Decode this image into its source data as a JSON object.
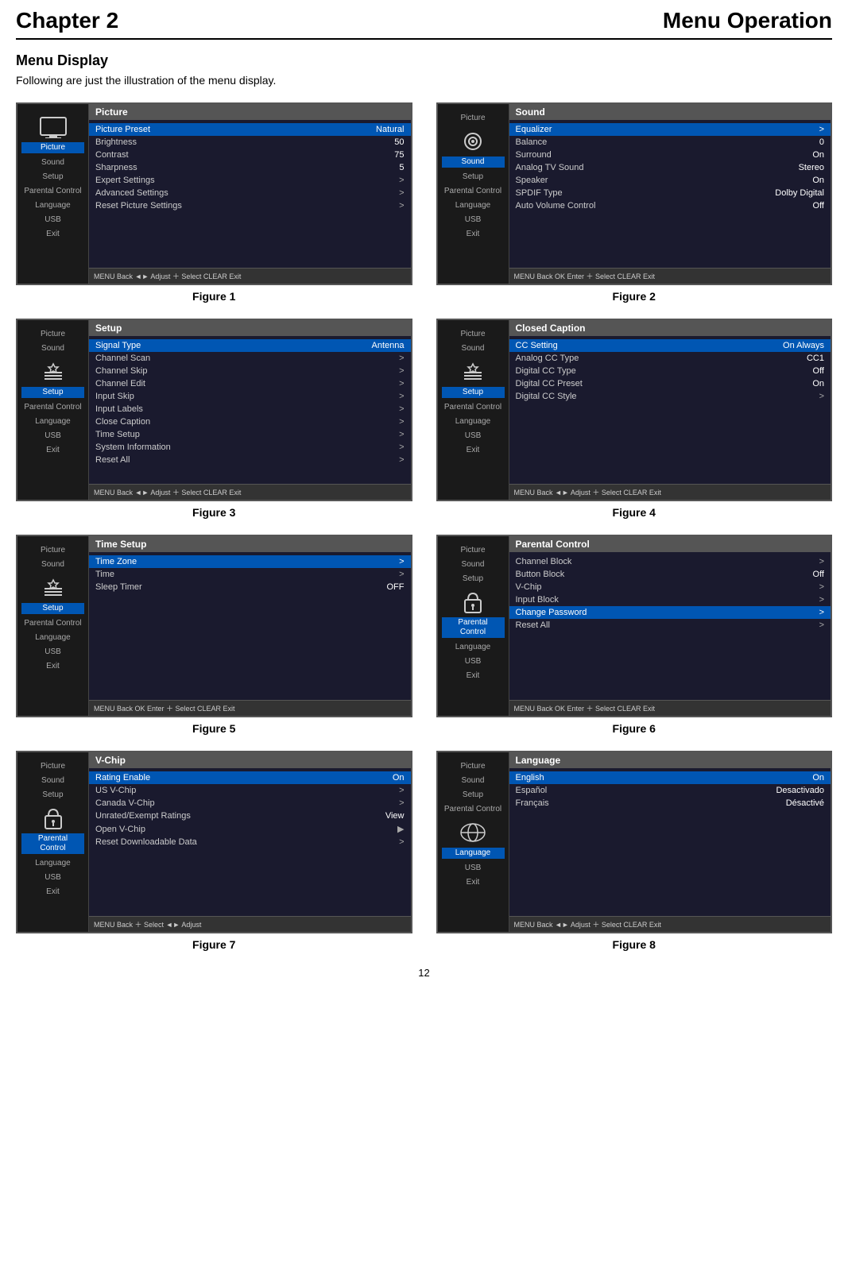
{
  "header": {
    "chapter": "Chapter 2",
    "title": "Menu Operation"
  },
  "section": {
    "heading": "Menu Display",
    "description": "Following are just the illustration of the menu display."
  },
  "figures": [
    {
      "id": "figure1",
      "label": "Figure 1",
      "sidebar_active": "Picture",
      "content_title": "Picture",
      "sidebar_items": [
        "Picture",
        "Sound",
        "Setup",
        "Parental Control",
        "Language",
        "USB",
        "Exit"
      ],
      "highlighted_row": "Picture Preset",
      "rows": [
        {
          "label": "Picture Preset",
          "value": "Natural",
          "arrow": ""
        },
        {
          "label": "Brightness",
          "value": "50",
          "arrow": ""
        },
        {
          "label": "Contrast",
          "value": "75",
          "arrow": ""
        },
        {
          "label": "Sharpness",
          "value": "5",
          "arrow": ""
        },
        {
          "label": "Expert Settings",
          "value": "",
          "arrow": ">"
        },
        {
          "label": "Advanced Settings",
          "value": "",
          "arrow": ">"
        },
        {
          "label": "Reset Picture Settings",
          "value": "",
          "arrow": ">"
        }
      ],
      "bottom": "MENU Back ◄► Adjust ＋ Select CLEAR Exit"
    },
    {
      "id": "figure2",
      "label": "Figure 2",
      "sidebar_active": "Sound",
      "content_title": "Sound",
      "sidebar_items": [
        "Picture",
        "Sound",
        "Setup",
        "Parental Control",
        "Language",
        "USB",
        "Exit"
      ],
      "highlighted_row": "Equalizer",
      "rows": [
        {
          "label": "Equalizer",
          "value": "",
          "arrow": ">"
        },
        {
          "label": "Balance",
          "value": "0",
          "arrow": ""
        },
        {
          "label": "Surround",
          "value": "On",
          "arrow": ""
        },
        {
          "label": "Analog TV Sound",
          "value": "Stereo",
          "arrow": ""
        },
        {
          "label": "Speaker",
          "value": "On",
          "arrow": ""
        },
        {
          "label": "SPDIF Type",
          "value": "Dolby Digital",
          "arrow": ""
        },
        {
          "label": "Auto Volume Control",
          "value": "Off",
          "arrow": ""
        }
      ],
      "bottom": "MENU Back OK Enter ＋ Select CLEAR Exit"
    },
    {
      "id": "figure3",
      "label": "Figure 3",
      "sidebar_active": "Setup",
      "content_title": "Setup",
      "sidebar_items": [
        "Picture",
        "Sound",
        "Setup",
        "Parental Control",
        "Language",
        "USB",
        "Exit"
      ],
      "highlighted_row": "Signal Type",
      "rows": [
        {
          "label": "Signal Type",
          "value": "Antenna",
          "arrow": ""
        },
        {
          "label": "Channel Scan",
          "value": "",
          "arrow": ">"
        },
        {
          "label": "Channel Skip",
          "value": "",
          "arrow": ">"
        },
        {
          "label": "Channel Edit",
          "value": "",
          "arrow": ">"
        },
        {
          "label": "Input Skip",
          "value": "",
          "arrow": ">"
        },
        {
          "label": "Input Labels",
          "value": "",
          "arrow": ">"
        },
        {
          "label": "Close Caption",
          "value": "",
          "arrow": ">"
        },
        {
          "label": "Time Setup",
          "value": "",
          "arrow": ">"
        },
        {
          "label": "System Information",
          "value": "",
          "arrow": ">"
        },
        {
          "label": "Reset All",
          "value": "",
          "arrow": ">"
        }
      ],
      "bottom": "MENU Back ◄► Adjust ＋ Select CLEAR Exit"
    },
    {
      "id": "figure4",
      "label": "Figure 4",
      "sidebar_active": "Setup",
      "content_title": "Closed Caption",
      "sidebar_items": [
        "Picture",
        "Sound",
        "Setup",
        "Parental Control",
        "Language",
        "USB",
        "Exit"
      ],
      "highlighted_row": "CC Setting",
      "rows": [
        {
          "label": "CC Setting",
          "value": "On Always",
          "arrow": ""
        },
        {
          "label": "Analog CC Type",
          "value": "CC1",
          "arrow": ""
        },
        {
          "label": "Digital CC Type",
          "value": "Off",
          "arrow": ""
        },
        {
          "label": "Digital CC Preset",
          "value": "On",
          "arrow": ""
        },
        {
          "label": "Digital CC Style",
          "value": "",
          "arrow": ">"
        }
      ],
      "bottom": "MENU Back ◄► Adjust ＋ Select CLEAR Exit"
    },
    {
      "id": "figure5",
      "label": "Figure 5",
      "sidebar_active": "Setup",
      "content_title": "Time Setup",
      "sidebar_items": [
        "Picture",
        "Sound",
        "Setup",
        "Parental Control",
        "Language",
        "USB",
        "Exit"
      ],
      "highlighted_row": "Time Zone",
      "rows": [
        {
          "label": "Time Zone",
          "value": "",
          "arrow": ">"
        },
        {
          "label": "Time",
          "value": "",
          "arrow": ">"
        },
        {
          "label": "Sleep Timer",
          "value": "OFF",
          "arrow": ""
        }
      ],
      "bottom": "MENU Back OK Enter ＋ Select CLEAR Exit"
    },
    {
      "id": "figure6",
      "label": "Figure 6",
      "sidebar_active": "Parental Control",
      "content_title": "Parental Control",
      "sidebar_items": [
        "Picture",
        "Sound",
        "Setup",
        "Parental Control",
        "Language",
        "USB",
        "Exit"
      ],
      "highlighted_row": "Change Password",
      "rows": [
        {
          "label": "Channel Block",
          "value": "",
          "arrow": ">"
        },
        {
          "label": "Button Block",
          "value": "Off",
          "arrow": ""
        },
        {
          "label": "V-Chip",
          "value": "",
          "arrow": ">"
        },
        {
          "label": "Input Block",
          "value": "",
          "arrow": ">"
        },
        {
          "label": "Change Password",
          "value": "",
          "arrow": ">"
        },
        {
          "label": "Reset All",
          "value": "",
          "arrow": ">"
        }
      ],
      "bottom": "MENU Back OK Enter ＋ Select CLEAR Exit"
    },
    {
      "id": "figure7",
      "label": "Figure 7",
      "sidebar_active": "Parental Control",
      "content_title": "V-Chip",
      "sidebar_items": [
        "Picture",
        "Sound",
        "Setup",
        "Parental Control",
        "Language",
        "USB",
        "Exit"
      ],
      "highlighted_row": "Rating Enable",
      "rows": [
        {
          "label": "Rating Enable",
          "value": "On",
          "arrow": ""
        },
        {
          "label": "US V-Chip",
          "value": "",
          "arrow": ">"
        },
        {
          "label": "Canada V-Chip",
          "value": "",
          "arrow": ">"
        },
        {
          "label": "Unrated/Exempt Ratings",
          "value": "View",
          "arrow": ""
        },
        {
          "label": "Open V-Chip",
          "value": "",
          "arrow": "▶"
        },
        {
          "label": "Reset Downloadable Data",
          "value": "",
          "arrow": ">"
        }
      ],
      "bottom": "MENU Back ＋ Select ◄► Adjust"
    },
    {
      "id": "figure8",
      "label": "Figure 8",
      "sidebar_active": "Language",
      "content_title": "Language",
      "sidebar_items": [
        "Picture",
        "Sound",
        "Setup",
        "Parental Control",
        "Language",
        "USB",
        "Exit"
      ],
      "highlighted_row": "English",
      "rows": [
        {
          "label": "English",
          "value": "On",
          "arrow": ""
        },
        {
          "label": "Español",
          "value": "Desactivado",
          "arrow": ""
        },
        {
          "label": "Français",
          "value": "Désactivé",
          "arrow": ""
        }
      ],
      "bottom": "MENU Back ◄► Adjust ＋ Select CLEAR Exit"
    }
  ],
  "page_number": "12"
}
